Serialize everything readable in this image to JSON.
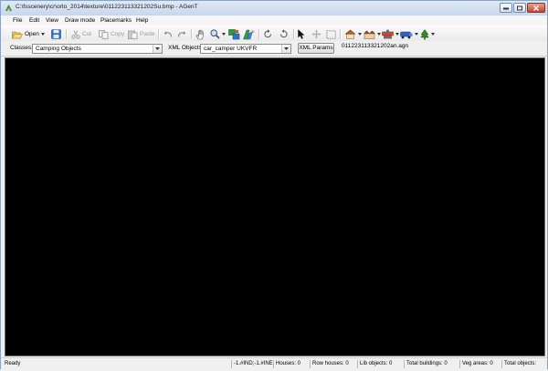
{
  "window": {
    "title": "C:\\fsscenery\\cr\\orto_2014\\texture\\011223113321202Su.bmp - AGenT"
  },
  "menu": [
    "File",
    "Edit",
    "View",
    "Draw mode",
    "Placemarks",
    "Help"
  ],
  "toolbar": {
    "open_label": "Open",
    "cut_label": "Cut",
    "copy_label": "Copy",
    "paste_label": "Paste"
  },
  "options": {
    "classes_label": "Classes:",
    "classes_value": "Camping Objects",
    "xml_objects_label": "XML Objects:",
    "xml_objects_value": "car_camper UKVFR",
    "xml_params_label": "XML Params",
    "agn_file": "011223113321202an.agn"
  },
  "status": {
    "ready": "Ready",
    "coords": "-1.#IND;-1.#INE",
    "houses": "Houses: 0",
    "row_houses": "Row houses: 0",
    "lib_objects": "Lib objects: 0",
    "total_buildings": "Total buildings: 0",
    "veg_areas": "Veg areas: 0",
    "total_objects": "Total objects:"
  },
  "colors": {
    "canvas": "#000000",
    "titlebar": "#c7d7ea",
    "chrome": "#f0f0f0"
  },
  "icons": {
    "app": "agent-logo-icon",
    "open": "folder-open-icon",
    "save": "floppy-disk-icon",
    "cut": "scissors-icon",
    "copy": "copy-icon",
    "paste": "paste-icon",
    "undo": "undo-icon",
    "redo": "redo-icon",
    "pan": "hand-icon",
    "zoom": "magnifier-icon",
    "rotate": "rotate-icons",
    "select": "pointer-icon",
    "houses": "house-icons",
    "vegetation": "tree-icon"
  }
}
